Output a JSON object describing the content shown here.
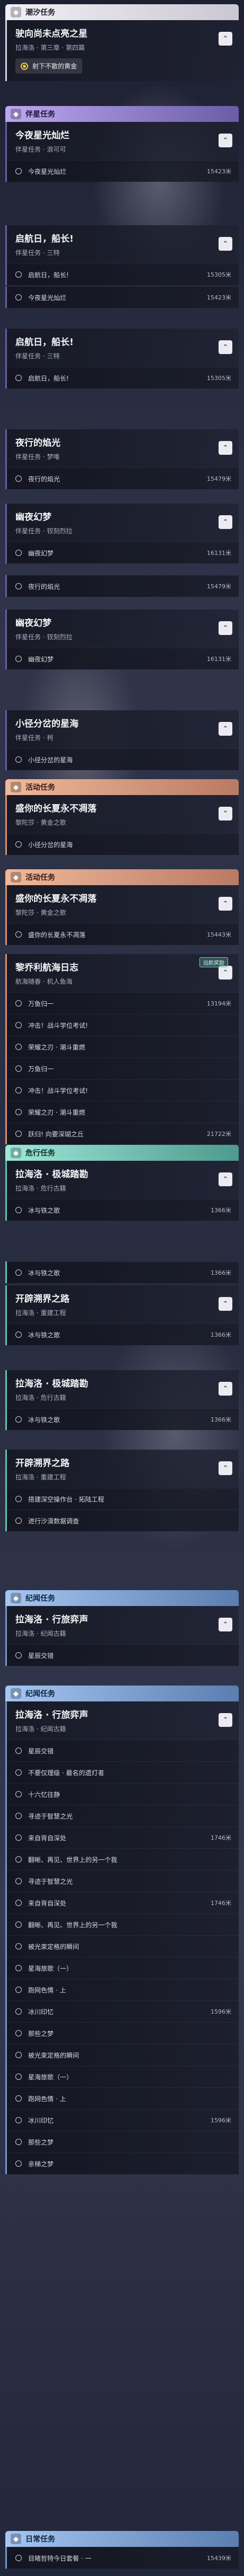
{
  "groups": {
    "tide": "潮汐任务",
    "companion": "伴星任务",
    "event": "活动任务",
    "hazard": "危行任务",
    "chronicle": "纪闻任务",
    "daily": "日常任务"
  },
  "common": {
    "sub_wei": "伴星任务 · 浪可可",
    "sub_santa": "伴星任务 · 三特",
    "sub_meng": "伴星任务 · 梦唯",
    "sub_chuanduo": "伴星任务 · 钗刻烈拉",
    "sub_ke": "伴星任务 · 柯",
    "sub_event": "黎陀莎 · 黄金之歌",
    "sub_exploration": "航海随春 · 机人鱼海",
    "sub_hazard1": "拉海洛 · 危行古籍",
    "sub_hazard2": "拉海洛 · 重建工程",
    "sub_chronicle": "拉海洛 · 纪闻古籍",
    "toggle": "⌃",
    "collapse": "⌄"
  },
  "tide": {
    "title": "驶向尚未点亮之星",
    "subtitle": "拉海洛 · 第三章 · 第四篇",
    "hint": "射下不散的黄金"
  },
  "companion_cards": [
    {
      "title": "今夜星光灿烂",
      "sub": "伴星任务 · 浪可可",
      "row": "今夜星光灿烂",
      "dist": "15423米"
    },
    {
      "title": "启航日，船长!",
      "sub": "伴星任务 · 三特",
      "row": "启航日，船长!",
      "dist": "15305米"
    },
    {
      "row": "今夜星光灿烂",
      "dist": "15423米"
    },
    {
      "title": "启航日，船长!",
      "sub": "伴星任务 · 三特",
      "row": "启航日，船长!",
      "dist": "15305米"
    },
    {
      "title": "夜行的焰光",
      "sub": "伴星任务 · 梦唯",
      "row": "夜行的焰光",
      "dist": "15479米"
    },
    {
      "title": "幽夜幻梦",
      "sub": "伴星任务 · 钗刻烈拉",
      "row": "幽夜幻梦",
      "dist": "16131米"
    },
    {
      "row": "夜行的焰光",
      "dist": "15479米"
    },
    {
      "title": "幽夜幻梦",
      "sub": "伴星任务 · 钗刻烈拉",
      "row": "幽夜幻梦",
      "dist": "16131米"
    },
    {
      "title": "小径分岔的星海",
      "sub": "伴星任务 · 柯",
      "row": "小径分岔的星海",
      "dist": ""
    }
  ],
  "event_cards": [
    {
      "title": "盛你的长夏永不凋落",
      "sub": "黎陀莎 · 黄金之歌",
      "row": "小径分岔的星海"
    },
    {
      "title": "盛你的长夏永不凋落",
      "sub": "黎陀莎 · 黄金之歌",
      "row": "盛你的长夏永不凋落",
      "dist": "15443米"
    },
    {
      "title": "黎乔利航海日志",
      "sub": "航海随春 · 机人鱼海",
      "badge": "远航奖励",
      "rows": [
        {
          "label": "万鱼归一",
          "dist": "13194米"
        },
        {
          "label": "冲击！战斗学位考试!",
          "dist": ""
        },
        {
          "label": "荣耀之刃 · 潮斗重燃",
          "dist": ""
        },
        {
          "label": "万鱼归一",
          "dist": ""
        },
        {
          "label": "冲击！战斗学位考试!",
          "dist": ""
        },
        {
          "label": "荣耀之刃 · 潮斗重燃",
          "dist": ""
        },
        {
          "label": "跃归! 向要深瑚之丘",
          "dist": "21722米"
        }
      ]
    }
  ],
  "hazard_cards": [
    {
      "title": "拉海洛 · 极城踏勘",
      "sub": "拉海洛 · 危行古籍",
      "row": "冰与铁之歌",
      "dist": "1366米"
    },
    {
      "row": "冰与铁之歌",
      "dist": "1366米"
    },
    {
      "title": "开辟溯界之路",
      "sub": "拉海洛 · 重建工程",
      "row": "冰与铁之歌",
      "dist": "1366米"
    },
    {
      "title": "拉海洛 · 极城踏勘",
      "sub": "拉海洛 · 危行古籍",
      "row": "冰与铁之歌",
      "dist": "1366米"
    },
    {
      "title": "开辟溯界之路",
      "sub": "拉海洛 · 重建工程",
      "rows": [
        {
          "label": "搭建深空操作台 · 拓陆工程"
        },
        {
          "label": "进行沙漠数据调查"
        }
      ]
    }
  ],
  "chronicle_cards": [
    {
      "title": "拉海洛 · 行旅弈声",
      "sub": "拉海洛 · 纪闻古籍",
      "row": "星辰交错"
    },
    {
      "title": "拉海洛 · 行旅弈声",
      "sub": "拉海洛 · 纪闻古籍",
      "rows": [
        {
          "label": "星辰交错",
          "dist": ""
        },
        {
          "label": "不要仅理级 · 最名的遗灯者",
          "dist": ""
        },
        {
          "label": "十六忆往静",
          "dist": ""
        },
        {
          "label": "寻迹于智慧之光",
          "dist": ""
        },
        {
          "label": "来自背自深处",
          "dist": "1746米"
        },
        {
          "label": "翻晰、再见、世界上的另一个我",
          "dist": ""
        },
        {
          "label": "寻迹于智慧之光",
          "dist": ""
        },
        {
          "label": "来自背自深处",
          "dist": "1746米"
        },
        {
          "label": "翻晰、再见、世界上的另一个我",
          "dist": ""
        },
        {
          "label": "被光束定格的瞬间",
          "dist": ""
        },
        {
          "label": "星海旅歌（一）",
          "dist": ""
        },
        {
          "label": "跑网色情 · 上",
          "dist": ""
        },
        {
          "label": "冰川印忆",
          "dist": "1596米"
        },
        {
          "label": "那些之梦",
          "dist": ""
        },
        {
          "label": "被光束定格的瞬间",
          "dist": ""
        },
        {
          "label": "星海旅歌（一）",
          "dist": ""
        },
        {
          "label": "跑网色情 · 上",
          "dist": ""
        },
        {
          "label": "冰川印忆",
          "dist": "1596米"
        },
        {
          "label": "那些之梦",
          "dist": ""
        },
        {
          "label": "亲梯之梦",
          "dist": ""
        }
      ]
    }
  ],
  "daily": {
    "row": "目睹哲特今日套餐 · 一",
    "dist": "15439米"
  }
}
